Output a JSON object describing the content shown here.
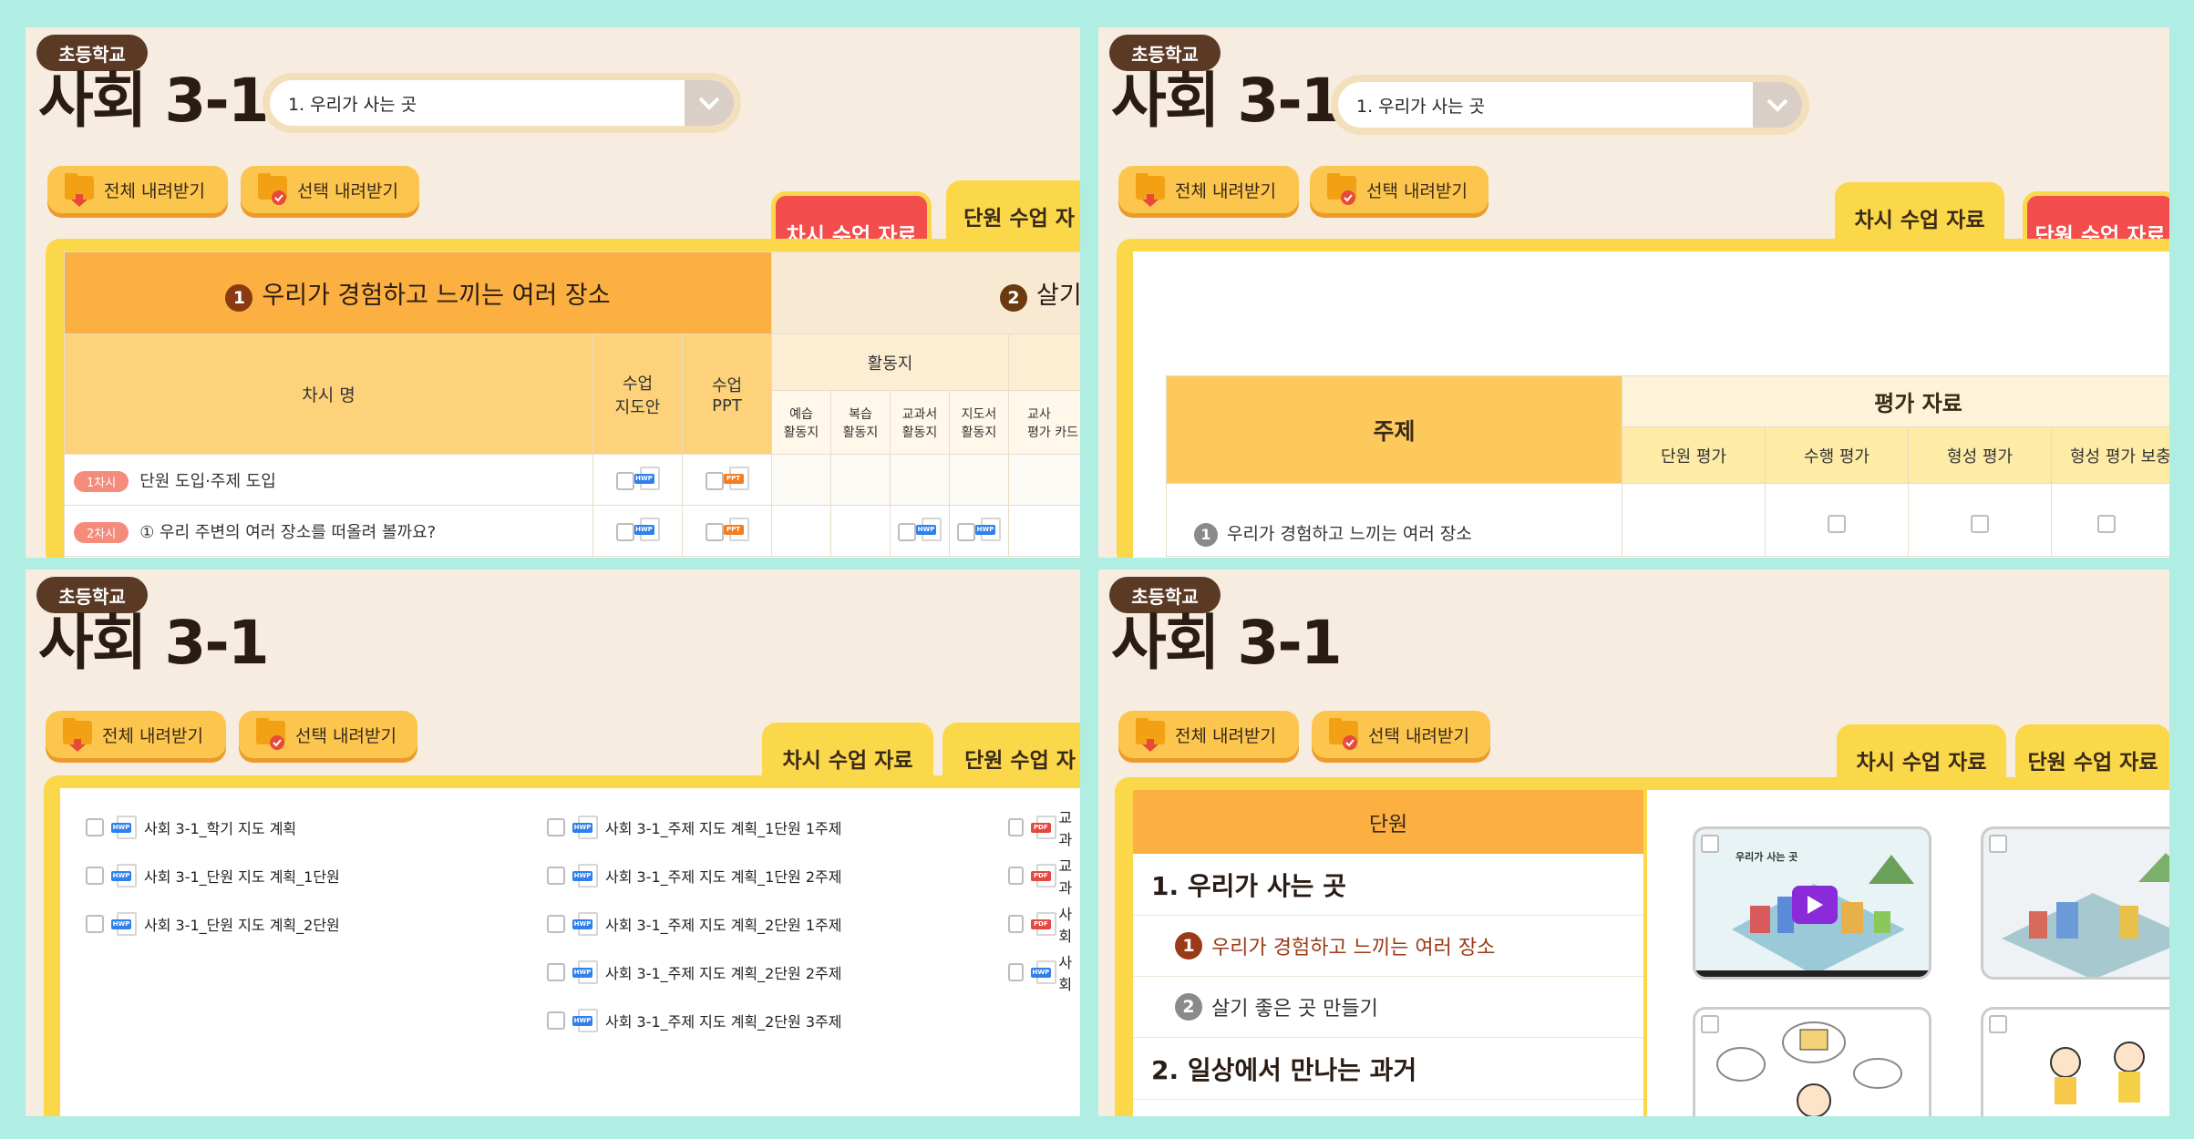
{
  "common": {
    "badge": "초등학교",
    "title": "사회 3-1",
    "unit_select": "1. 우리가 사는 곳",
    "download_all": "전체 내려받기",
    "download_selected": "선택 내려받기",
    "tab_lesson": "차시 수업 자료",
    "tab_unit": "단원 수업 자료",
    "tab_unit_cut": "단원 수업 자"
  },
  "panel1": {
    "section1_num": "1",
    "section1_title": "우리가 경험하고 느끼는 여러 장소",
    "section2_num": "2",
    "section2_title": "살기",
    "col_lesson_name": "차시 명",
    "col_guide": "수업\n지도안",
    "col_ppt": "수업\nPPT",
    "group_activity": "활동지",
    "sub_cols": [
      "예습\n활동지",
      "복습\n활동지",
      "교과서\n활동지",
      "지도서\n활동지",
      "교사\n평가 카드"
    ],
    "rows": [
      {
        "badge": "1차시",
        "name": "단원 도입·주제 도입"
      },
      {
        "badge": "2차시",
        "name": "① 우리 주변의 여러 장소를 떠올려 볼까요?"
      }
    ]
  },
  "panel2": {
    "col_topic": "주제",
    "group_eval": "평가 자료",
    "eval_cols": [
      "단원 평가",
      "수행 평가",
      "형성 평가",
      "형성 평가 보충"
    ],
    "row_num": "1",
    "row_title": "우리가 경험하고 느끼는 여러 장소"
  },
  "panel3": {
    "col1": [
      {
        "type": "HWP",
        "name": "사회 3-1_학기 지도 계획"
      },
      {
        "type": "HWP",
        "name": "사회 3-1_단원 지도 계획_1단원"
      },
      {
        "type": "HWP",
        "name": "사회 3-1_단원 지도 계획_2단원"
      }
    ],
    "col2": [
      {
        "type": "HWP",
        "name": "사회 3-1_주제 지도 계획_1단원 1주제"
      },
      {
        "type": "HWP",
        "name": "사회 3-1_주제 지도 계획_1단원 2주제"
      },
      {
        "type": "HWP",
        "name": "사회 3-1_주제 지도 계획_2단원 1주제"
      },
      {
        "type": "HWP",
        "name": "사회 3-1_주제 지도 계획_2단원 2주제"
      },
      {
        "type": "HWP",
        "name": "사회 3-1_주제 지도 계획_2단원 3주제"
      }
    ],
    "col3": [
      {
        "type": "PDF",
        "name": "교과"
      },
      {
        "type": "PDF",
        "name": "교과"
      },
      {
        "type": "PDF",
        "name": "사회"
      },
      {
        "type": "HWP",
        "name": "사회"
      }
    ]
  },
  "panel4": {
    "header": "단원",
    "unit1": "1. 우리가 사는 곳",
    "topic1_num": "1",
    "topic1": "우리가 경험하고 느끼는 여러 장소",
    "topic2_num": "2",
    "topic2": "살기 좋은 곳 만들기",
    "unit2": "2. 일상에서 만나는 과거",
    "video_title": "우리가 사는 곳"
  }
}
